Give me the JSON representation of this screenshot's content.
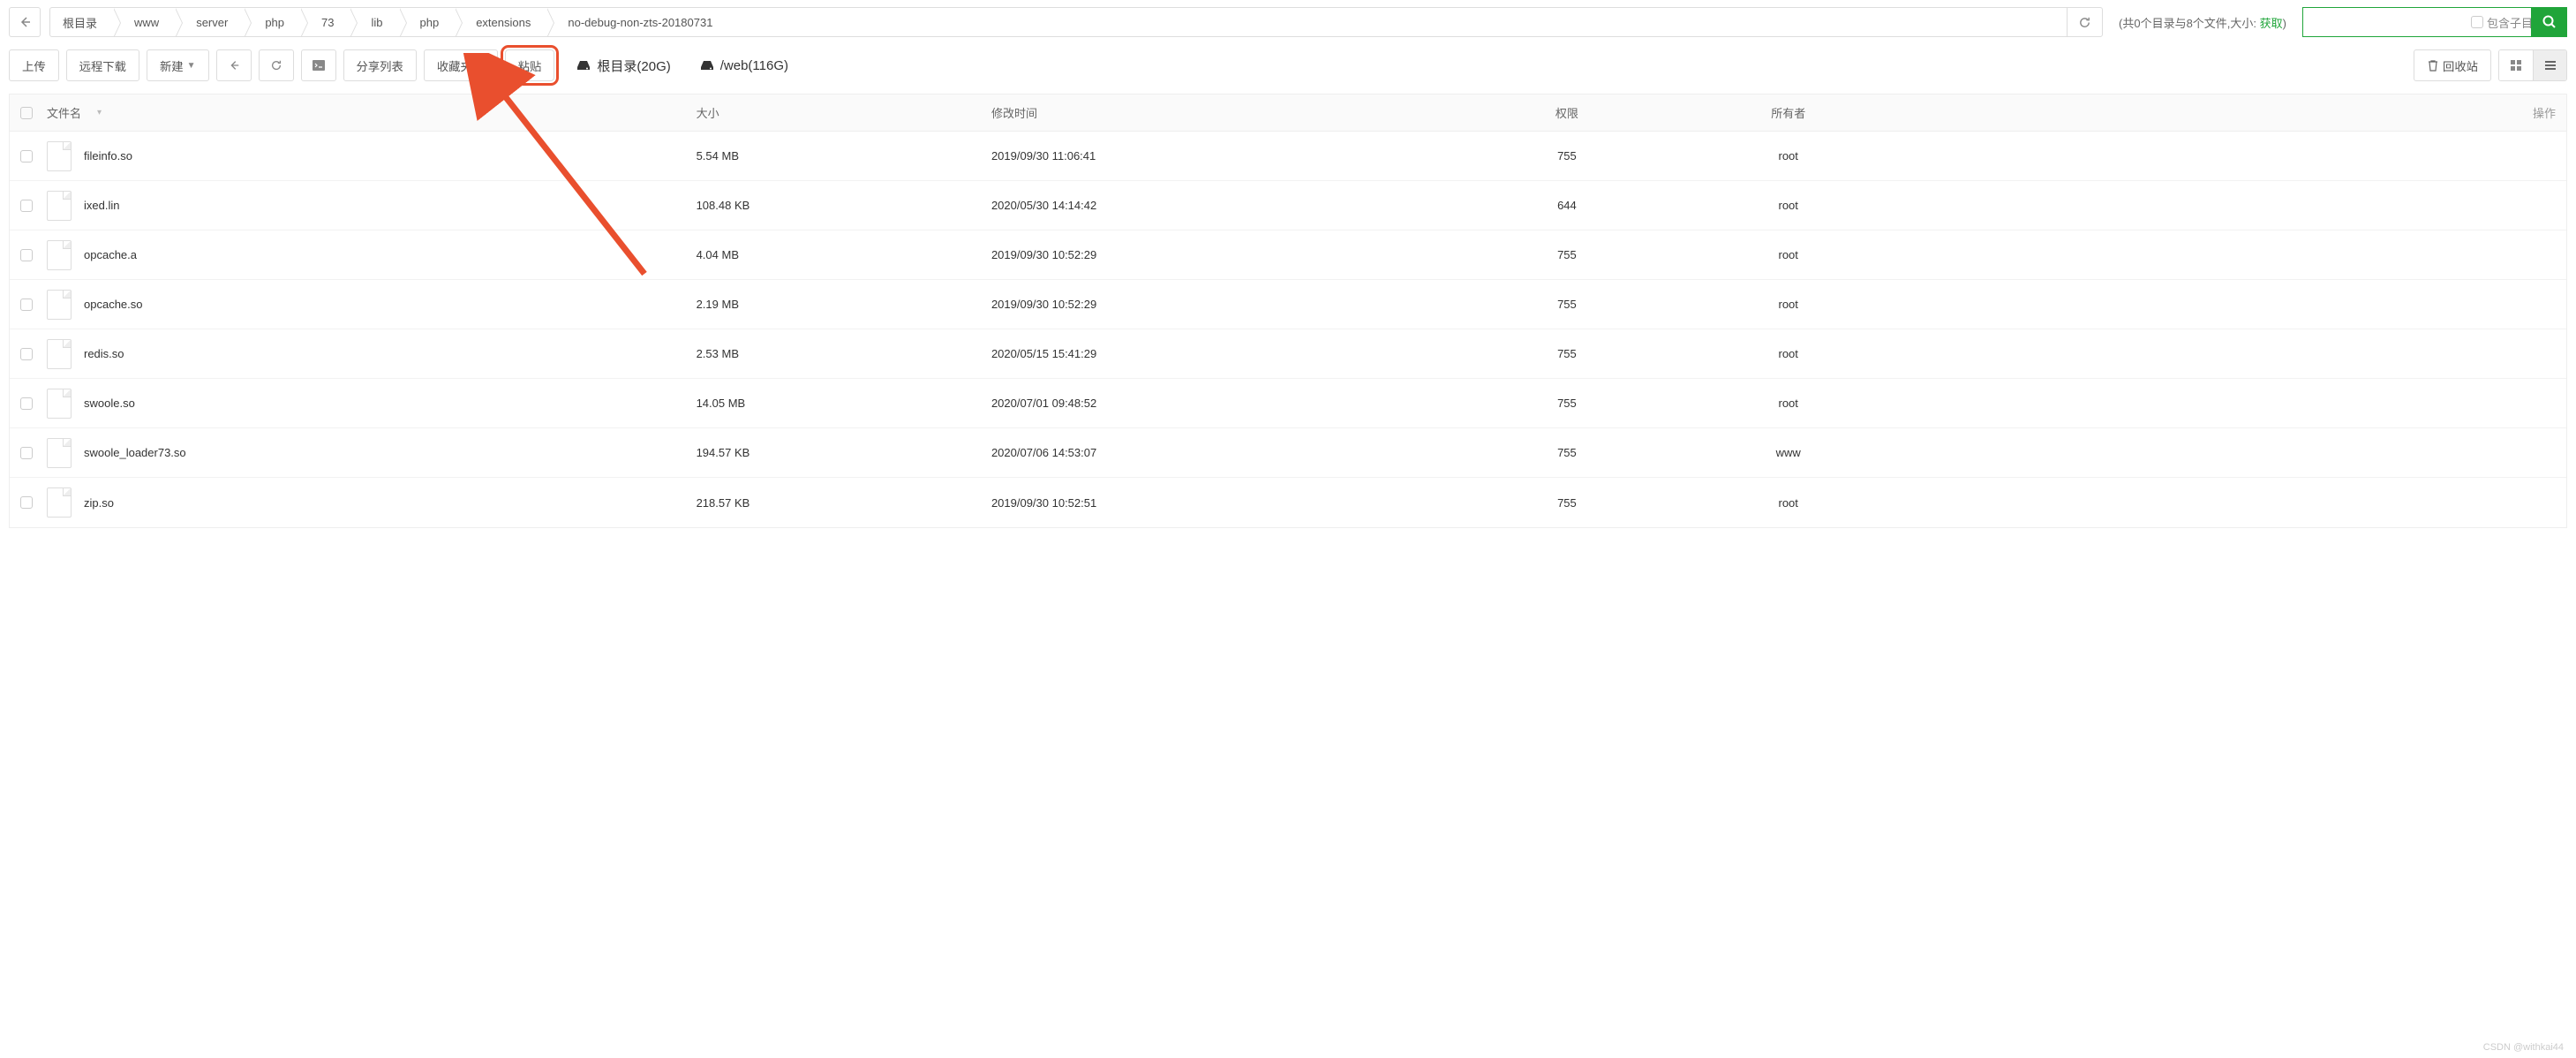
{
  "breadcrumb": [
    "根目录",
    "www",
    "server",
    "php",
    "73",
    "lib",
    "php",
    "extensions",
    "no-debug-non-zts-20180731"
  ],
  "summary": {
    "prefix": "(共0个目录与8个文件,大小: ",
    "link": "获取",
    "suffix": ")"
  },
  "search": {
    "placeholder": "",
    "include_sub_label": "包含子目录"
  },
  "toolbar": {
    "upload": "上传",
    "remote_download": "远程下载",
    "new": "新建",
    "share_list": "分享列表",
    "favorites": "收藏夹",
    "paste": "粘贴",
    "recycle": "回收站"
  },
  "disks": [
    {
      "label": "根目录(20G)"
    },
    {
      "label": "/web(116G)"
    }
  ],
  "columns": {
    "name": "文件名",
    "size": "大小",
    "mtime": "修改时间",
    "perm": "权限",
    "owner": "所有者",
    "action": "操作"
  },
  "files": [
    {
      "name": "fileinfo.so",
      "size": "5.54 MB",
      "mtime": "2019/09/30 11:06:41",
      "perm": "755",
      "owner": "root"
    },
    {
      "name": "ixed.lin",
      "size": "108.48 KB",
      "mtime": "2020/05/30 14:14:42",
      "perm": "644",
      "owner": "root"
    },
    {
      "name": "opcache.a",
      "size": "4.04 MB",
      "mtime": "2019/09/30 10:52:29",
      "perm": "755",
      "owner": "root"
    },
    {
      "name": "opcache.so",
      "size": "2.19 MB",
      "mtime": "2019/09/30 10:52:29",
      "perm": "755",
      "owner": "root"
    },
    {
      "name": "redis.so",
      "size": "2.53 MB",
      "mtime": "2020/05/15 15:41:29",
      "perm": "755",
      "owner": "root"
    },
    {
      "name": "swoole.so",
      "size": "14.05 MB",
      "mtime": "2020/07/01 09:48:52",
      "perm": "755",
      "owner": "root"
    },
    {
      "name": "swoole_loader73.so",
      "size": "194.57 KB",
      "mtime": "2020/07/06 14:53:07",
      "perm": "755",
      "owner": "www"
    },
    {
      "name": "zip.so",
      "size": "218.57 KB",
      "mtime": "2019/09/30 10:52:51",
      "perm": "755",
      "owner": "root"
    }
  ],
  "watermark": "CSDN @withkai44"
}
